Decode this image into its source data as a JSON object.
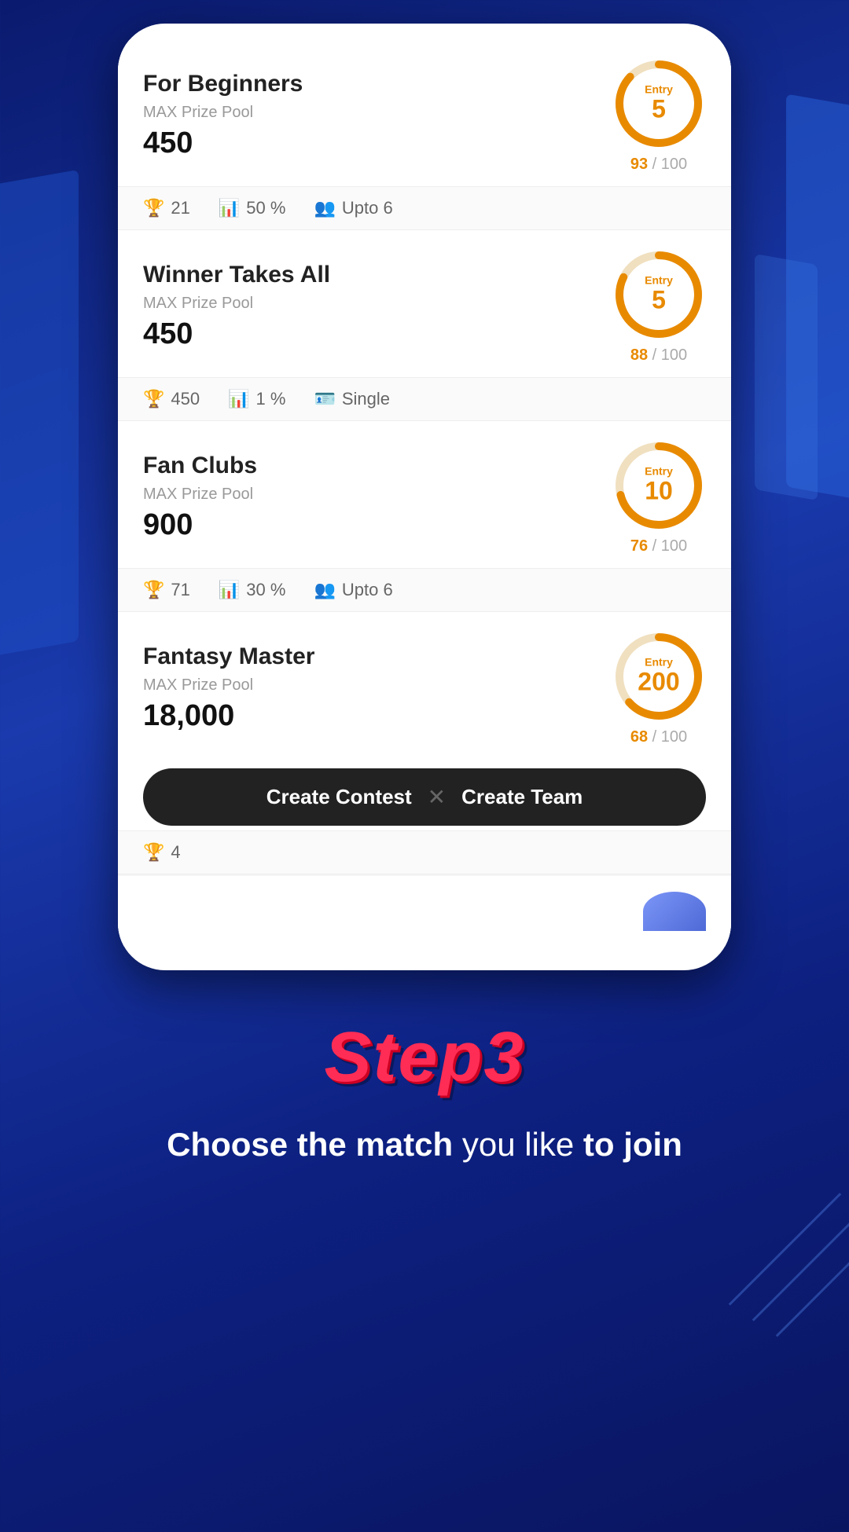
{
  "background": {
    "color1": "#0a1a6e",
    "color2": "#1a3aad"
  },
  "contests": [
    {
      "id": "for-beginners",
      "title": "For Beginners",
      "prize_label": "MAX Prize Pool",
      "prize": "450",
      "entry": "5",
      "filled": 93,
      "total": 100,
      "stats": [
        {
          "icon": "trophy",
          "value": "21"
        },
        {
          "icon": "chart",
          "value": "50 %"
        },
        {
          "icon": "team",
          "value": "Upto 6"
        }
      ]
    },
    {
      "id": "winner-takes-all",
      "title": "Winner Takes All",
      "prize_label": "MAX Prize Pool",
      "prize": "450",
      "entry": "5",
      "filled": 88,
      "total": 100,
      "stats": [
        {
          "icon": "trophy",
          "value": "450"
        },
        {
          "icon": "chart",
          "value": "1 %"
        },
        {
          "icon": "team",
          "value": "Single"
        }
      ]
    },
    {
      "id": "fan-clubs",
      "title": "Fan Clubs",
      "prize_label": "MAX Prize Pool",
      "prize": "900",
      "entry": "10",
      "filled": 76,
      "total": 100,
      "stats": [
        {
          "icon": "trophy",
          "value": "71"
        },
        {
          "icon": "chart",
          "value": "30 %"
        },
        {
          "icon": "team",
          "value": "Upto 6"
        }
      ]
    },
    {
      "id": "fantasy-master",
      "title": "Fantasy Master",
      "prize_label": "MAX Prize Pool",
      "prize": "18,000",
      "entry": "200",
      "filled": 68,
      "total": 100,
      "stats": [
        {
          "icon": "trophy",
          "value": "4"
        }
      ]
    }
  ],
  "action_bar": {
    "create_contest": "Create Contest",
    "divider": "✕",
    "create_team": "Create Team"
  },
  "step": {
    "title": "Step3",
    "description_bold1": "Choose the match",
    "description_normal": " you like ",
    "description_bold2": "to join"
  }
}
